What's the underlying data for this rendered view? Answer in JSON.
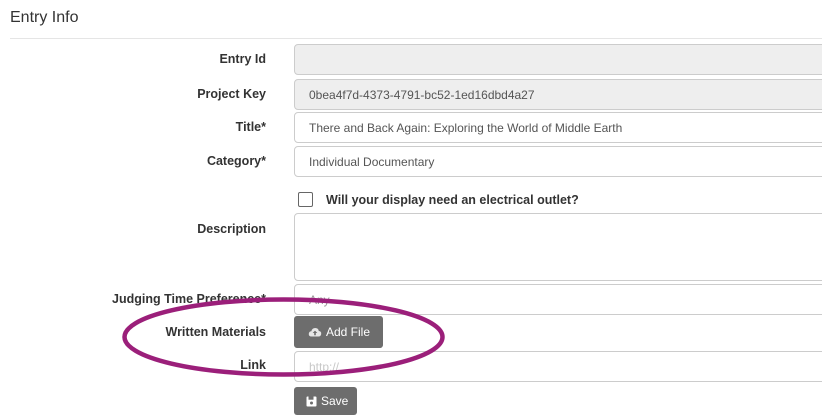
{
  "section": {
    "title": "Entry Info"
  },
  "fields": {
    "entry_id": {
      "label": "Entry Id",
      "value": ""
    },
    "project_key": {
      "label": "Project Key",
      "value": "0bea4f7d-4373-4791-bc52-1ed16dbd4a27"
    },
    "title": {
      "label": "Title*",
      "value": "There and Back Again: Exploring the World of Middle Earth"
    },
    "category": {
      "label": "Category*",
      "value": "Individual Documentary"
    },
    "electrical_outlet": {
      "label": "Will your display need an electrical outlet?",
      "checked": false
    },
    "description": {
      "label": "Description",
      "value": ""
    },
    "judging_time": {
      "label": "Judging Time Preference*",
      "value": "Any"
    },
    "written_materials": {
      "label": "Written Materials",
      "button_label": "Add File"
    },
    "link": {
      "label": "Link",
      "placeholder": "http://"
    }
  },
  "actions": {
    "save_label": "Save"
  },
  "annotation": {
    "color": "#9b1f7a",
    "shape": "ellipse"
  },
  "icons": {
    "add_file": "cloud-upload-icon",
    "save": "floppy-disk-icon",
    "select": "chevron-down-icon"
  }
}
